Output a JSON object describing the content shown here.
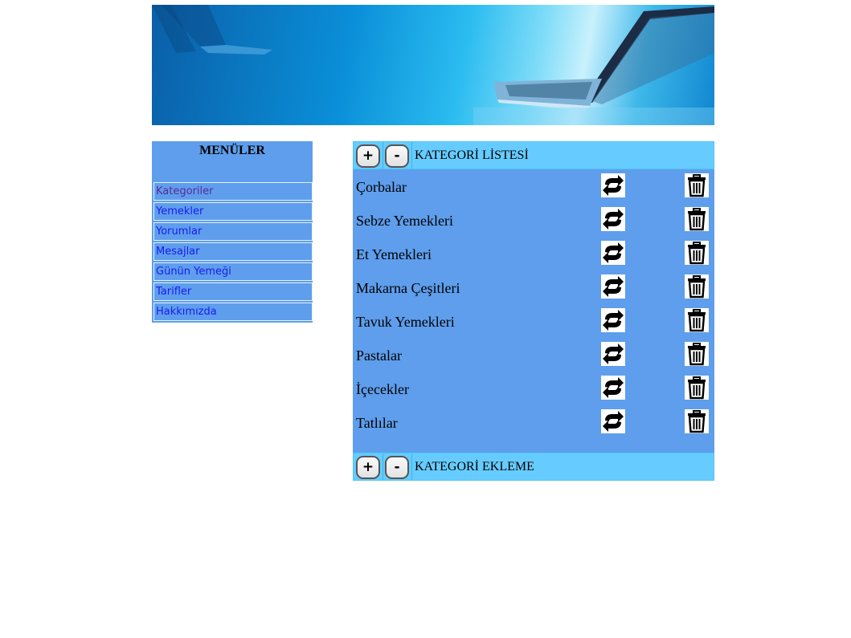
{
  "banner": {
    "icon": "laptop-banner-image"
  },
  "menu": {
    "title": "MENÜLER",
    "items": [
      {
        "label": "Kategoriler",
        "visited": true
      },
      {
        "label": "Yemekler"
      },
      {
        "label": "Yorumlar"
      },
      {
        "label": "Mesajlar"
      },
      {
        "label": "Günün Yemeği"
      },
      {
        "label": "Tarifler"
      },
      {
        "label": "Hakkımızda"
      }
    ]
  },
  "list_panel": {
    "expand_label": "+",
    "collapse_label": "-",
    "title": "KATEGORİ LİSTESİ",
    "categories": [
      {
        "name": "Çorbalar"
      },
      {
        "name": "Sebze Yemekleri"
      },
      {
        "name": "Et Yemekleri"
      },
      {
        "name": "Makarna Çeşitleri"
      },
      {
        "name": "Tavuk Yemekleri"
      },
      {
        "name": "Pastalar"
      },
      {
        "name": "İçecekler"
      },
      {
        "name": "Tatlılar"
      }
    ],
    "update_icon": "refresh-icon",
    "delete_icon": "trash-icon"
  },
  "add_panel": {
    "expand_label": "+",
    "collapse_label": "-",
    "title": "KATEGORİ EKLEME"
  },
  "colors": {
    "menu_bg": "#5e9eec",
    "panel_bg": "#5e9eec",
    "header_bar": "#66ccff",
    "link": "#1a1af0",
    "visited_link": "#5a2a9a"
  }
}
